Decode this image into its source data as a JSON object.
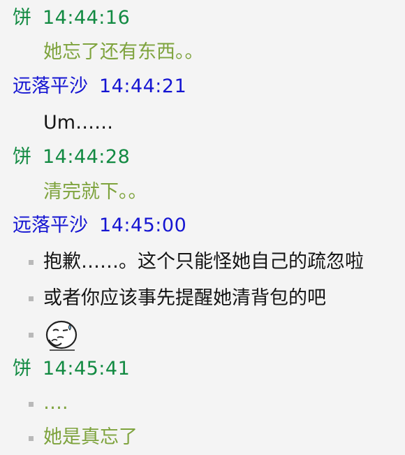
{
  "colors": {
    "green": "#128a42",
    "blue": "#1515d2",
    "olive": "#7ea33d",
    "black": "#141414",
    "bullet": "#b9b9b9"
  },
  "messages": [
    {
      "sender": "饼",
      "time": "14:44:16",
      "lines": [
        "她忘了还有东西。。"
      ]
    },
    {
      "sender": "远落平沙",
      "time": "14:44:21",
      "lines": [
        "Um……"
      ]
    },
    {
      "sender": "饼",
      "time": "14:44:28",
      "lines": [
        "清完就下。。"
      ]
    },
    {
      "sender": "远落平沙",
      "time": "14:45:00",
      "lines": [
        "抱歉……。这个只能怪她自己的疏忽啦",
        "或者你应该事先提醒她清背包的吧"
      ],
      "emoji": "sweating-thinking-face-emoji"
    },
    {
      "sender": "饼",
      "time": "14:45:41",
      "lines": [
        "….",
        "她是真忘了"
      ]
    }
  ]
}
